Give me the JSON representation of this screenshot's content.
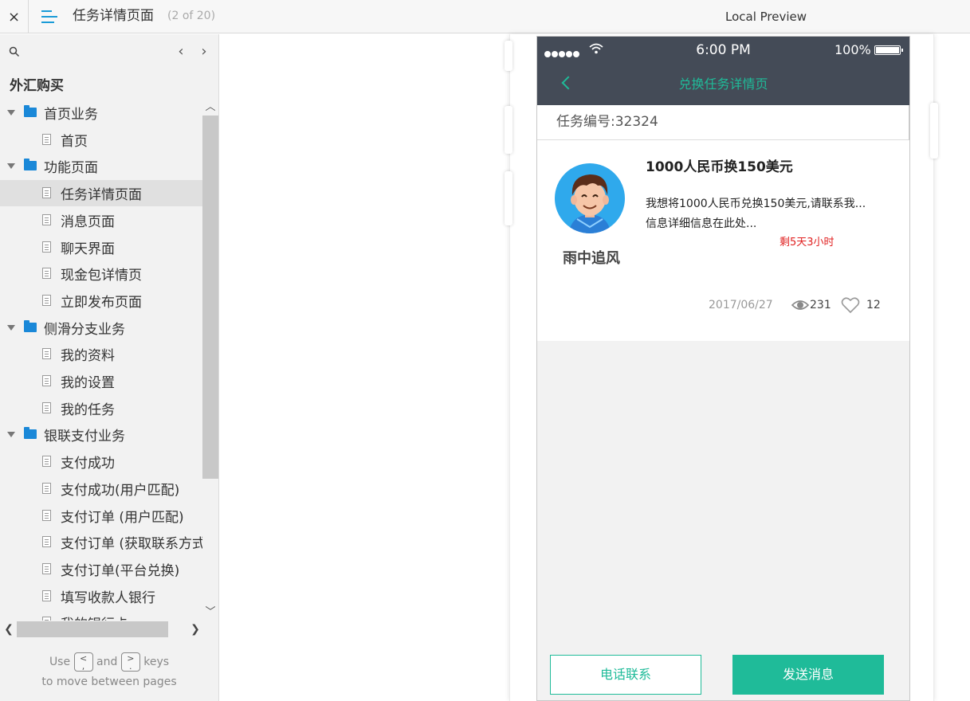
{
  "topbar": {
    "close_label": "×",
    "page_title": "任务详情页面",
    "page_count": "(2 of 20)",
    "preview_label": "Local Preview"
  },
  "sidebar": {
    "project_name": "外汇购买",
    "prev_label": "‹",
    "next_label": "›",
    "tree": [
      {
        "type": "folder",
        "label": "首页业务"
      },
      {
        "type": "page",
        "label": "首页"
      },
      {
        "type": "folder",
        "label": "功能页面"
      },
      {
        "type": "page",
        "label": "任务详情页面",
        "selected": true
      },
      {
        "type": "page",
        "label": "消息页面"
      },
      {
        "type": "page",
        "label": "聊天界面"
      },
      {
        "type": "page",
        "label": "现金包详情页"
      },
      {
        "type": "page",
        "label": "立即发布页面"
      },
      {
        "type": "folder",
        "label": "侧滑分支业务"
      },
      {
        "type": "page",
        "label": "我的资料"
      },
      {
        "type": "page",
        "label": "我的设置"
      },
      {
        "type": "page",
        "label": "我的任务"
      },
      {
        "type": "folder",
        "label": "银联支付业务"
      },
      {
        "type": "page",
        "label": "支付成功"
      },
      {
        "type": "page",
        "label": "支付成功(用户匹配)"
      },
      {
        "type": "page",
        "label": "支付订单 (用户匹配)"
      },
      {
        "type": "page",
        "label": "支付订单 (获取联系方式"
      },
      {
        "type": "page",
        "label": "支付订单(平台兑换)"
      },
      {
        "type": "page",
        "label": "填写收款人银行"
      },
      {
        "type": "page",
        "label": "我的银行卡"
      }
    ],
    "hint": {
      "use": "Use",
      "and": "and",
      "keys": "keys",
      "line2": "to move between pages",
      "key_prev": "<\n,",
      "key_next": ">\n."
    }
  },
  "phone": {
    "status": {
      "time": "6:00 PM",
      "battery": "100%"
    },
    "nav_title": "兑换任务详情页",
    "task_number": "任务编号:32324",
    "card": {
      "username": "雨中追风",
      "title": "1000人民币换150美元",
      "desc_line1": "我想将1000人民币兑换150美元,请联系我...",
      "desc_line2": "信息详细信息在此处...",
      "remaining": "剩5天3小时",
      "date": "2017/06/27",
      "views": "231",
      "likes": "12"
    },
    "buttons": {
      "call": "电话联系",
      "send": "发送消息"
    }
  },
  "colors": {
    "accent": "#1fbb99",
    "nav_bg": "#444b57",
    "warning": "#e02020",
    "folder": "#1a88d8"
  }
}
